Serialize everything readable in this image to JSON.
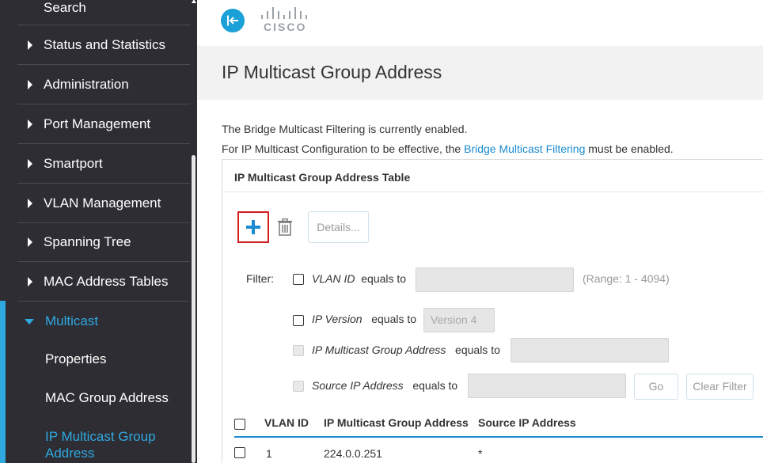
{
  "sidebar": {
    "search_label": "Search",
    "items": [
      {
        "label": "Status and Statistics"
      },
      {
        "label": "Administration"
      },
      {
        "label": "Port Management"
      },
      {
        "label": "Smartport"
      },
      {
        "label": "VLAN Management"
      },
      {
        "label": "Spanning Tree"
      },
      {
        "label": "MAC Address Tables"
      }
    ],
    "multicast": {
      "label": "Multicast",
      "children": [
        {
          "label": "Properties"
        },
        {
          "label": "MAC Group Address"
        },
        {
          "label": "IP Multicast Group Address"
        }
      ]
    },
    "accent_color": "#30a8e0"
  },
  "header": {
    "brand": "CISCO",
    "back_icon": "collapse-arrow-icon"
  },
  "page": {
    "title": "IP Multicast Group Address",
    "info_line1": "The Bridge Multicast Filtering is currently enabled.",
    "info_line2_prefix": "For IP Multicast Configuration to be effective, the ",
    "info_line2_link": "Bridge Multicast Filtering",
    "info_line2_suffix": " must be enabled."
  },
  "table_panel": {
    "title": "IP Multicast Group Address Table",
    "toolbar": {
      "add_icon": "plus-icon",
      "delete_icon": "trash-icon",
      "details_label": "Details..."
    },
    "filter": {
      "label": "Filter:",
      "vlan_id": {
        "label": "VLAN ID",
        "suffix": "equals to",
        "value": "",
        "range": "(Range: 1 - 4094)"
      },
      "ip_version": {
        "label": "IP Version",
        "suffix": "equals to",
        "value": "Version 4"
      },
      "group_address": {
        "label": "IP Multicast Group Address",
        "suffix": "equals to",
        "value": ""
      },
      "source_ip": {
        "label": "Source IP Address",
        "suffix": "equals to",
        "value": ""
      },
      "go_label": "Go",
      "clear_label": "Clear Filter"
    },
    "columns": [
      "VLAN ID",
      "IP Multicast Group Address",
      "Source IP Address"
    ],
    "rows": [
      {
        "vlan_id": "1",
        "group_address": "224.0.0.251",
        "source_ip": "*"
      }
    ]
  },
  "colors": {
    "link": "#1b8ccf",
    "highlight_border": "#d21f1f",
    "sidebar_bg": "#2d2d33"
  }
}
